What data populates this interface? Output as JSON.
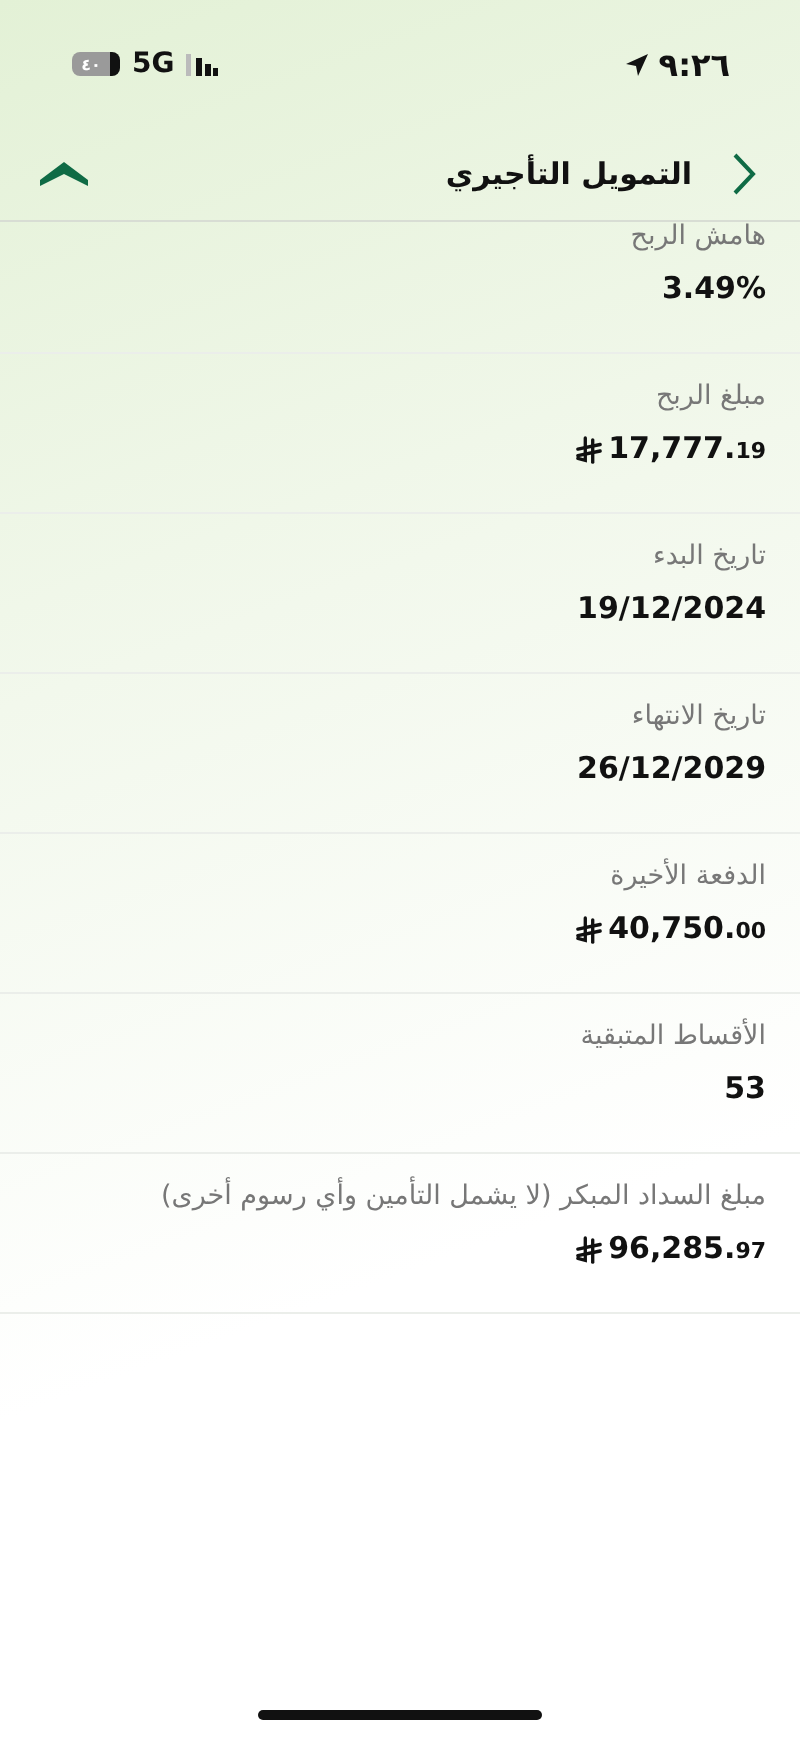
{
  "status_bar": {
    "time": "٩:٢٦",
    "network": "5G",
    "battery_text": "٤٠"
  },
  "header": {
    "title": "التمويل التأجيري"
  },
  "rows": [
    {
      "kind": "text",
      "label": "هامش الربح",
      "value": "3.49%"
    },
    {
      "kind": "amount",
      "label": "مبلغ الربح",
      "whole": "17,777.",
      "fraction": "19"
    },
    {
      "kind": "text",
      "label": "تاريخ البدء",
      "value": "19/12/2024"
    },
    {
      "kind": "text",
      "label": "تاريخ الانتهاء",
      "value": "26/12/2029"
    },
    {
      "kind": "amount",
      "label": "الدفعة الأخيرة",
      "whole": "40,750.",
      "fraction": "00"
    },
    {
      "kind": "text",
      "label": "الأقساط المتبقية",
      "value": "53"
    },
    {
      "kind": "amount",
      "label": "مبلغ السداد المبكر (لا يشمل التأمين وأي رسوم أخرى)",
      "whole": "96,285.",
      "fraction": "97"
    }
  ]
}
